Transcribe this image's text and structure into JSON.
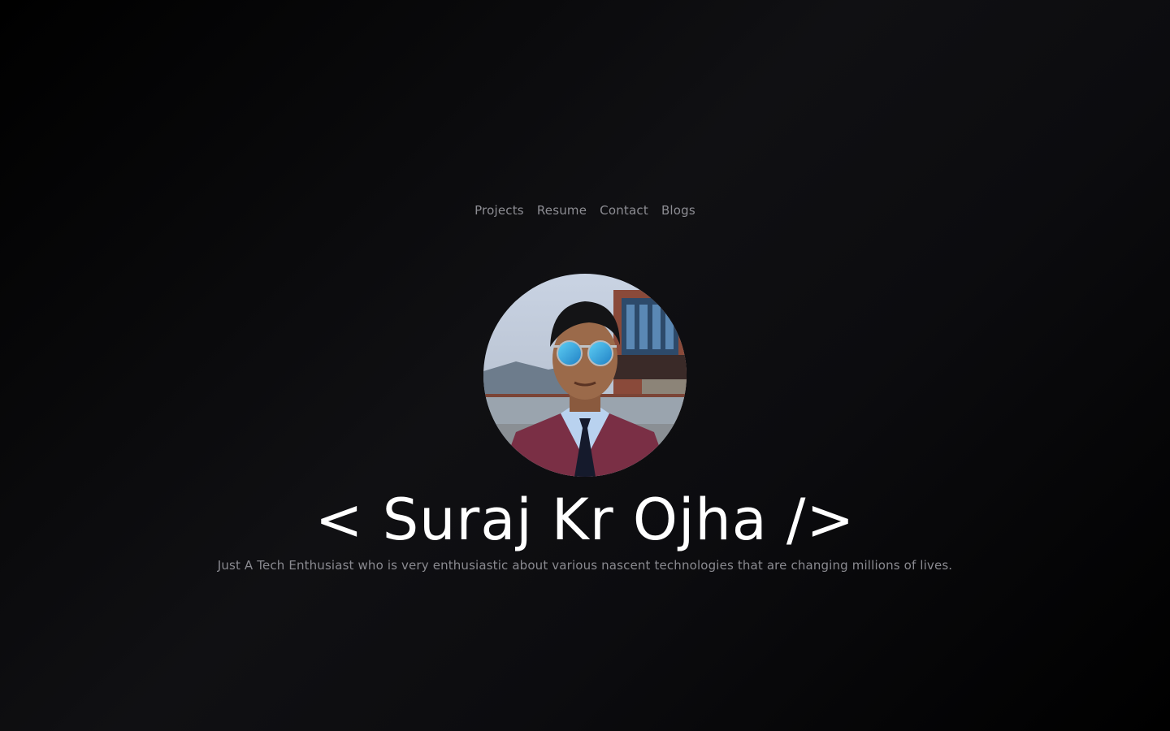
{
  "nav": {
    "items": [
      {
        "label": "Projects"
      },
      {
        "label": "Resume"
      },
      {
        "label": "Contact"
      },
      {
        "label": "Blogs"
      }
    ]
  },
  "hero": {
    "avatar_icon": "profile-photo",
    "name": "< Suraj Kr Ojha />",
    "tagline": "Just A Tech Enthusiast who is very enthusiastic about various nascent technologies that are changing millions of lives."
  },
  "colors": {
    "background": "#0c0c0f",
    "nav_text": "#8d8d93",
    "heading": "#ffffff",
    "tagline": "#8a8a90"
  }
}
